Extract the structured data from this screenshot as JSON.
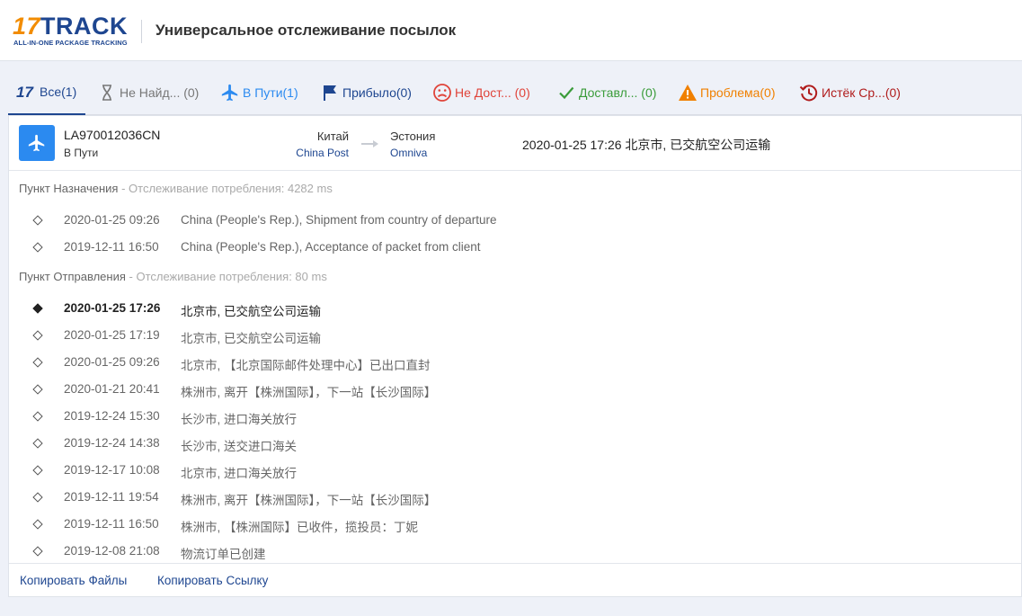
{
  "header": {
    "logo_main_a": "17",
    "logo_main_b": "TRACK",
    "logo_sub": "ALL-IN-ONE PACKAGE TRACKING",
    "title": "Универсальное отслеживание посылок"
  },
  "tabs": [
    {
      "label": "Все(1)",
      "icon": "seventeen-logo-icon",
      "color": "#1e4690"
    },
    {
      "label": "Не Найд... (0)",
      "icon": "hourglass-icon",
      "color": "#777777"
    },
    {
      "label": "В Пути(1)",
      "icon": "plane-icon",
      "color": "#2b8af0"
    },
    {
      "label": "Прибыло(0)",
      "icon": "flag-icon",
      "color": "#1e4690"
    },
    {
      "label": "Не Дост... (0)",
      "icon": "sad-face-icon",
      "color": "#e0443a"
    },
    {
      "label": "Доставл... (0)",
      "icon": "checkmark-icon",
      "color": "#3a9c3a"
    },
    {
      "label": "Проблема(0)",
      "icon": "warning-icon",
      "color": "#f08000"
    },
    {
      "label": "Истёк Ср...(0)",
      "icon": "history-clock-icon",
      "color": "#b01c1c"
    }
  ],
  "shipment": {
    "tracking_number": "LA970012036CN",
    "status": "В Пути",
    "origin_country": "Китай",
    "origin_carrier": "China Post",
    "destination_country": "Эстония",
    "destination_carrier": "Omniva",
    "latest_event": "2020-01-25 17:26  北京市, 已交航空公司运输"
  },
  "destination_section": {
    "label": "Пункт Назначения",
    "meta": " - Отслеживание потребления: 4282 ms",
    "events": [
      {
        "time": "2020-01-25 09:26",
        "desc": "China (People's Rep.), Shipment from country of departure"
      },
      {
        "time": "2019-12-11 16:50",
        "desc": "China (People's Rep.), Acceptance of packet from client"
      }
    ]
  },
  "origin_section": {
    "label": "Пункт Отправления",
    "meta": " - Отслеживание потребления: 80 ms",
    "events": [
      {
        "time": "2020-01-25 17:26",
        "desc": "北京市, 已交航空公司运输"
      },
      {
        "time": "2020-01-25 17:19",
        "desc": "北京市, 已交航空公司运输"
      },
      {
        "time": "2020-01-25 09:26",
        "desc": "北京市, 【北京国际邮件处理中心】已出口直封"
      },
      {
        "time": "2020-01-21 20:41",
        "desc": "株洲市, 离开【株洲国际】，下一站【长沙国际】"
      },
      {
        "time": "2019-12-24 15:30",
        "desc": "长沙市, 进口海关放行"
      },
      {
        "time": "2019-12-24 14:38",
        "desc": "长沙市, 送交进口海关"
      },
      {
        "time": "2019-12-17 10:08",
        "desc": "北京市, 进口海关放行"
      },
      {
        "time": "2019-12-11 19:54",
        "desc": "株洲市, 离开【株洲国际】，下一站【长沙国际】"
      },
      {
        "time": "2019-12-11 16:50",
        "desc": "株洲市, 【株洲国际】已收件，揽投员：丁妮"
      },
      {
        "time": "2019-12-08 21:08",
        "desc": "物流订单已创建"
      }
    ]
  },
  "footer": {
    "copy_files": "Копировать Файлы",
    "copy_link": "Копировать Ссылку"
  },
  "colors": {
    "brand_blue": "#1e4690",
    "brand_orange": "#f28c00",
    "accent_blue": "#2b8af0"
  }
}
